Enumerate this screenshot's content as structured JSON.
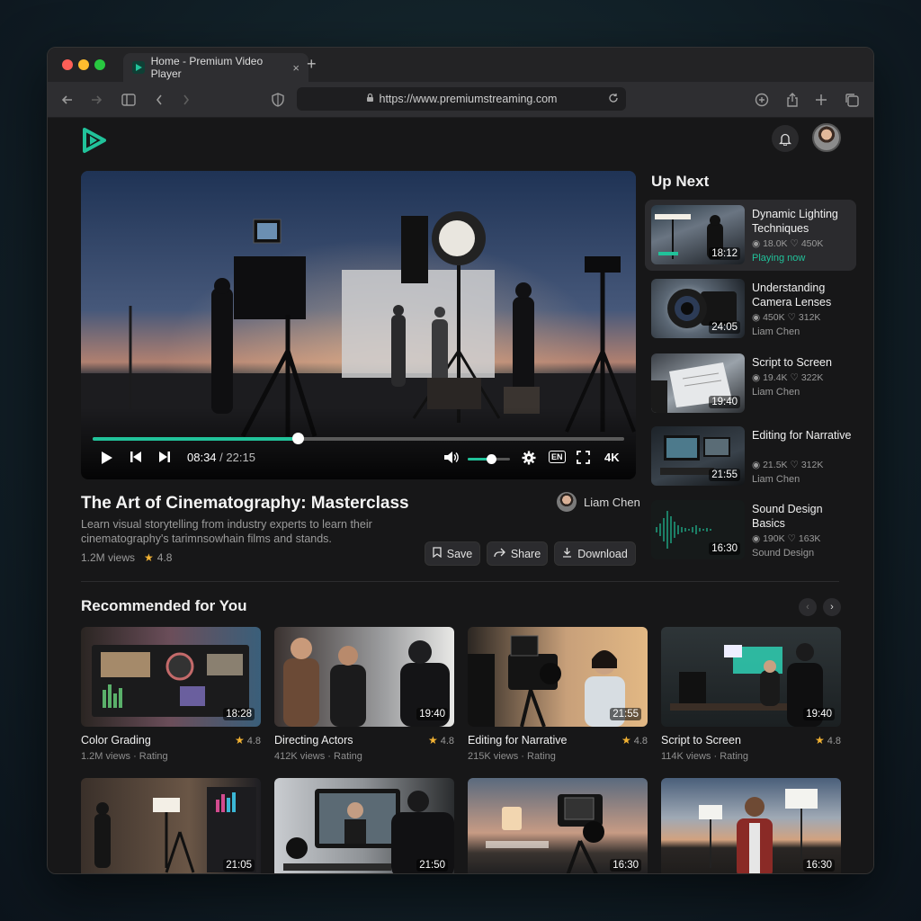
{
  "browser": {
    "tab_title": "Home - Premium Video Player",
    "tab_close": "×",
    "new_tab": "+",
    "url": "https://www.premiumstreaming.com"
  },
  "player": {
    "time_current": "08:34",
    "time_separator": " / ",
    "time_duration": "22:15",
    "progress": 0.385,
    "volume": 0.55,
    "cc_label": "EN",
    "quality": "4K"
  },
  "video": {
    "title": "The Art of Cinematography: Masterclass",
    "description": "Learn visual storytelling from industry experts to learn their cinematography's tarimnsowhain films and stands.",
    "views": "1.2M views",
    "rating": "4.8",
    "author": "Liam Chen",
    "save_label": "Save",
    "share_label": "Share",
    "download_label": "Download"
  },
  "up_next": {
    "heading": "Up Next",
    "items": [
      {
        "title": "Dynamic Lighting Techniques",
        "duration": "18:12",
        "views": "18.0K",
        "likes": "450K",
        "sub": "Playing now"
      },
      {
        "title": "Understanding Camera Lenses",
        "duration": "24:05",
        "views": "450K",
        "likes": "312K",
        "sub": "Liam Chen"
      },
      {
        "title": "Script to Screen",
        "duration": "19:40",
        "views": "19.4K",
        "likes": "322K",
        "sub": "Liam Chen"
      },
      {
        "title": "Editing for Narrative",
        "duration": "21:55",
        "views": "21.5K",
        "likes": "312K",
        "sub": "Liam Chen"
      },
      {
        "title": "Sound Design Basics",
        "duration": "16:30",
        "views": "190K",
        "likes": "163K",
        "sub": "Sound Design"
      }
    ]
  },
  "recommended": {
    "heading": "Recommended for You",
    "prev": "‹",
    "next": "›",
    "items": [
      {
        "title": "Color Grading",
        "duration": "18:28",
        "rating": "4.8",
        "sub": "1.2M views · Rating"
      },
      {
        "title": "Directing Actors",
        "duration": "19:40",
        "rating": "4.8",
        "sub": "412K views · Rating"
      },
      {
        "title": "Editing for Narrative",
        "duration": "21:55",
        "rating": "4.8",
        "sub": "215K views · Rating"
      },
      {
        "title": "Script to Screen",
        "duration": "19:40",
        "rating": "4.8",
        "sub": "114K views · Rating"
      },
      {
        "duration": "21:05"
      },
      {
        "duration": "21:50"
      },
      {
        "duration": "16:30"
      },
      {
        "duration": "16:30"
      }
    ]
  },
  "colors": {
    "accent": "#21c29a",
    "star": "#f2b233",
    "background": "#171718"
  }
}
